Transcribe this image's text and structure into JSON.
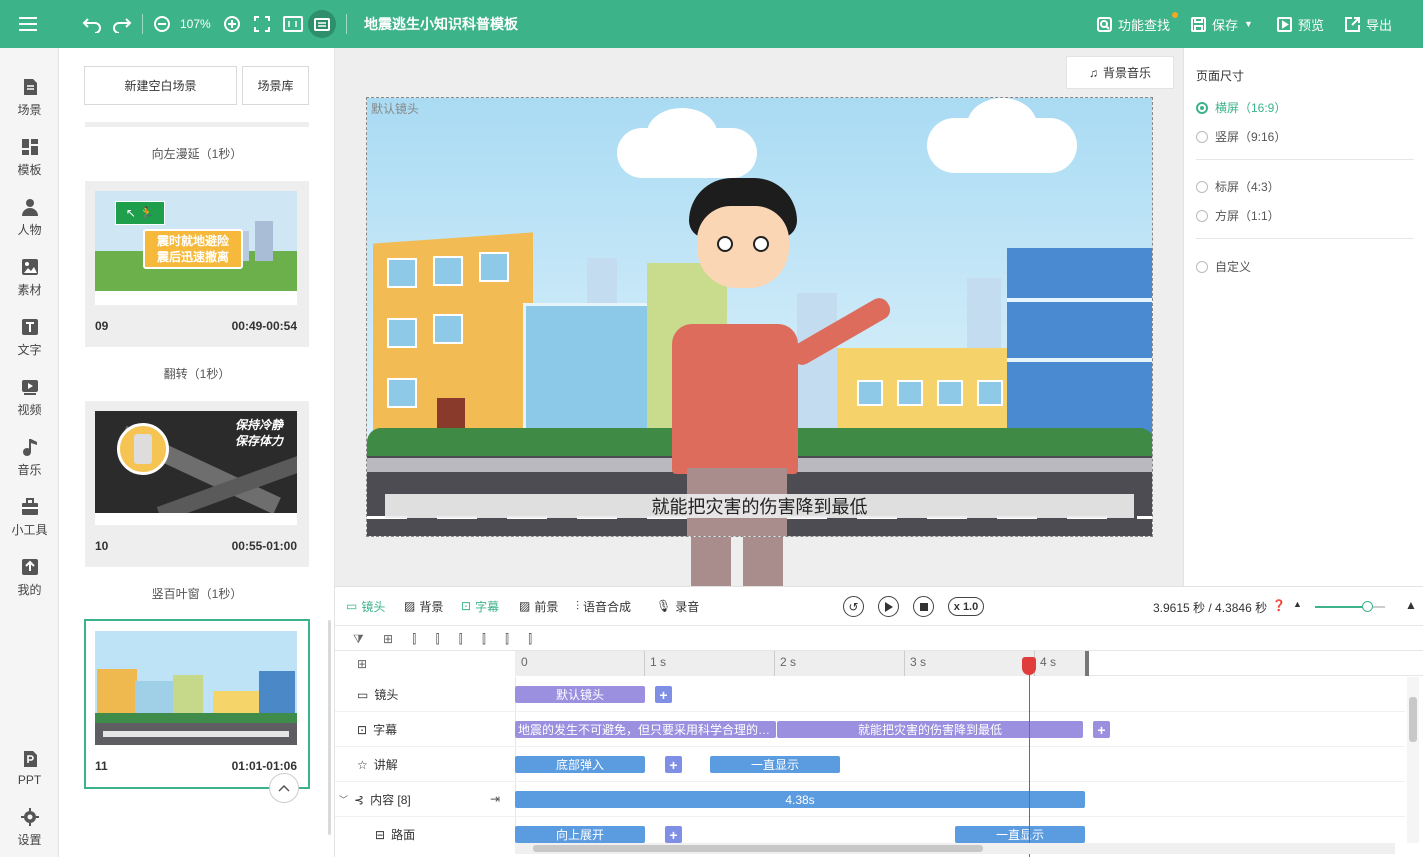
{
  "topbar": {
    "zoom": "107%",
    "title": "地震逃生小知识科普模板",
    "feature_search": "功能查找",
    "save": "保存",
    "preview": "预览",
    "export": "导出"
  },
  "rail": {
    "items": [
      {
        "label": "场景",
        "icon": "scene-icon"
      },
      {
        "label": "模板",
        "icon": "template-icon"
      },
      {
        "label": "人物",
        "icon": "person-icon"
      },
      {
        "label": "素材",
        "icon": "material-icon"
      },
      {
        "label": "文字",
        "icon": "text-icon"
      },
      {
        "label": "视频",
        "icon": "video-icon"
      },
      {
        "label": "音乐",
        "icon": "music-icon"
      },
      {
        "label": "小工具",
        "icon": "toolbox-icon"
      },
      {
        "label": "我的",
        "icon": "upload-icon"
      }
    ],
    "bottom": [
      {
        "label": "PPT",
        "icon": "ppt-icon"
      },
      {
        "label": "设置",
        "icon": "gear-icon"
      }
    ]
  },
  "scenes": {
    "new_blank": "新建空白场景",
    "library": "场景库",
    "transitions": [
      "向左漫延（1秒）",
      "翻转（1秒）",
      "竖百叶窗（1秒）"
    ],
    "cards": [
      {
        "num": "09",
        "time": "00:49-00:54",
        "thumb_text": [
          "震时就地避险",
          "震后迅速撤离"
        ]
      },
      {
        "num": "10",
        "time": "00:55-01:00",
        "thumb_text": [
          "保持冷静",
          "保存体力"
        ]
      },
      {
        "num": "11",
        "time": "01:01-01:06"
      }
    ]
  },
  "canvas": {
    "bg_music": "背景音乐",
    "camera_label": "默认镜头",
    "subtitle": "就能把灾害的伤害降到最低"
  },
  "props": {
    "title": "页面尺寸",
    "options": [
      {
        "label": "横屏（16:9）",
        "selected": true
      },
      {
        "label": "竖屏（9:16）",
        "selected": false
      },
      {
        "label": "标屏（4:3）",
        "selected": false
      },
      {
        "label": "方屏（1:1）",
        "selected": false
      },
      {
        "label": "自定义",
        "selected": false
      }
    ]
  },
  "timeline": {
    "tabs": [
      {
        "label": "镜头",
        "active": true
      },
      {
        "label": "背景",
        "active": false
      },
      {
        "label": "字幕",
        "active": true
      },
      {
        "label": "前景",
        "active": false
      },
      {
        "label": "语音合成",
        "active": false
      },
      {
        "label": "录音",
        "active": false
      }
    ],
    "speed": "x 1.0",
    "time_readout": "3.9615 秒 / 4.3846 秒",
    "ruler": [
      "0",
      "1 s",
      "2 s",
      "3 s",
      "4 s"
    ],
    "playhead_seconds": 3.9615,
    "tracks": [
      {
        "label": "镜头",
        "clips": [
          "默认镜头"
        ]
      },
      {
        "label": "字幕",
        "clips": [
          "地震的发生不可避免，但只要采用科学合理的…",
          "就能把灾害的伤害降到最低"
        ]
      },
      {
        "label": "讲解",
        "clips": [
          "底部弹入",
          "一直显示"
        ]
      },
      {
        "label": "内容 [8]",
        "clips": [
          "4.38s"
        ]
      },
      {
        "label": "路面",
        "clips": [
          "向上展开",
          "一直显示"
        ]
      }
    ]
  }
}
